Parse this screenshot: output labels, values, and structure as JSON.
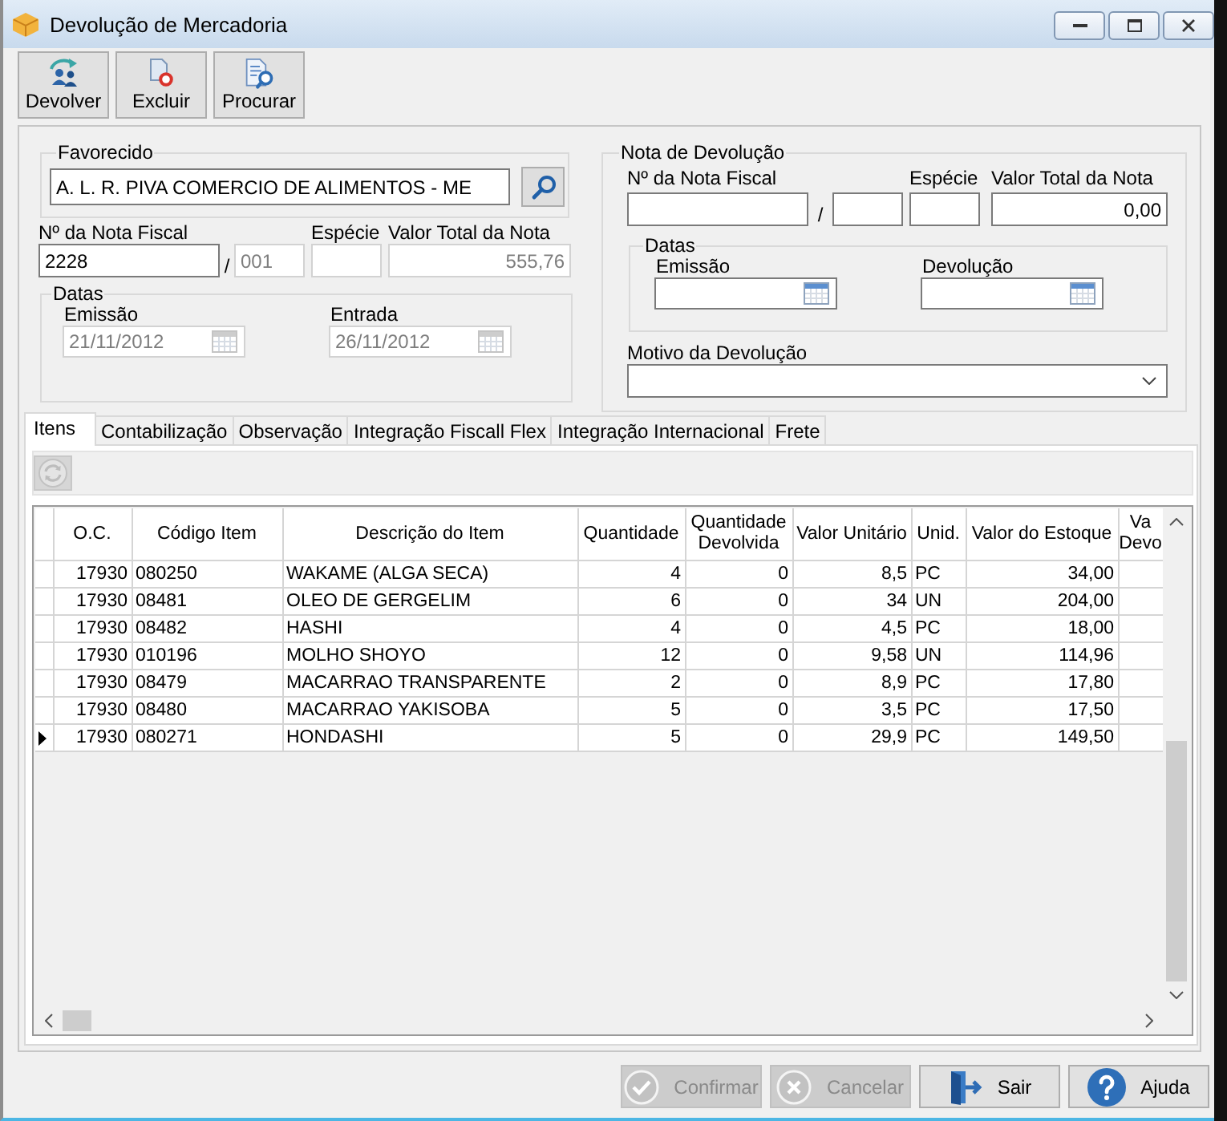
{
  "window": {
    "title": "Devolução de Mercadoria"
  },
  "toolbar": [
    {
      "kind": "return",
      "label": "Devolver"
    },
    {
      "kind": "delete",
      "label": "Excluir"
    },
    {
      "kind": "find",
      "label": "Procurar"
    }
  ],
  "favorecido": {
    "legend": "Favorecido",
    "field": {
      "value": "A. L. R. PIVA COMERCIO DE ALIMENTOS - ME",
      "disabled": false
    }
  },
  "nota_fiscal": {
    "number_label": "Nº da Nota Fiscal",
    "number": {
      "value": "2228",
      "disabled": false
    },
    "separator": "/",
    "series": {
      "value": "001",
      "disabled": true
    },
    "especie_label": "Espécie",
    "especie": {
      "disabled": true
    },
    "total_label": "Valor Total da Nota",
    "total": {
      "value": "555,76",
      "disabled": true
    },
    "datas": {
      "legend": "Datas",
      "fields": [
        {
          "label": "Emissão",
          "value": "21/11/2012",
          "disabled": true
        },
        {
          "label": "Entrada",
          "value": "26/11/2012",
          "disabled": true
        }
      ]
    }
  },
  "nota_devolucao": {
    "legend": "Nota de Devolução",
    "number_label": "Nº da Nota Fiscal",
    "number": {
      "disabled": false
    },
    "separator": "/",
    "series": {
      "disabled": false
    },
    "especie_label": "Espécie",
    "especie": {
      "disabled": false
    },
    "total_label": "Valor Total da Nota",
    "total": {
      "value": "0,00",
      "disabled": false
    },
    "datas": {
      "legend": "Datas",
      "fields": [
        {
          "label": "Emissão",
          "disabled": false
        },
        {
          "label": "Devolução",
          "disabled": false
        }
      ]
    },
    "motivo_label": "Motivo da Devolução",
    "motivo": {
      "disabled": false
    }
  },
  "tabs": [
    {
      "label": "Itens",
      "selected": true
    },
    {
      "label": "Contabilização",
      "selected": false
    },
    {
      "label": "Observação",
      "selected": false
    },
    {
      "label": "Integração Fiscall Flex",
      "selected": false
    },
    {
      "label": "Integração Internacional",
      "selected": false
    },
    {
      "label": "Frete",
      "selected": false
    }
  ],
  "items_toolbar": {
    "refresh_disabled": true
  },
  "grid": {
    "columns": [
      "O.C.",
      "Código Item",
      "Descrição do Item",
      "Quantidade",
      "Quantidade Devolvida",
      "Valor Unitário",
      "Unid.",
      "Valor do Estoque",
      "Va Devo"
    ],
    "rows": [
      {
        "cells": [
          "17930",
          "080250",
          "WAKAME (ALGA SECA)",
          "4",
          "0",
          "8,5",
          "PC",
          "34,00"
        ],
        "selected": false
      },
      {
        "cells": [
          "17930",
          "08481",
          "OLEO DE GERGELIM",
          "6",
          "0",
          "34",
          "UN",
          "204,00"
        ],
        "selected": false
      },
      {
        "cells": [
          "17930",
          "08482",
          "HASHI",
          "4",
          "0",
          "4,5",
          "PC",
          "18,00"
        ],
        "selected": false
      },
      {
        "cells": [
          "17930",
          "010196",
          "MOLHO SHOYO",
          "12",
          "0",
          "9,58",
          "UN",
          "114,96"
        ],
        "selected": false
      },
      {
        "cells": [
          "17930",
          "08479",
          "MACARRAO TRANSPARENTE",
          "2",
          "0",
          "8,9",
          "PC",
          "17,80"
        ],
        "selected": false
      },
      {
        "cells": [
          "17930",
          "08480",
          "MACARRAO YAKISOBA",
          "5",
          "0",
          "3,5",
          "PC",
          "17,50"
        ],
        "selected": false
      },
      {
        "cells": [
          "17930",
          "080271",
          "HONDASHI",
          "5",
          "0",
          "29,9",
          "PC",
          "149,50"
        ],
        "selected": true
      }
    ]
  },
  "buttons": [
    {
      "kind": "confirm",
      "label": "Confirmar",
      "disabled": true
    },
    {
      "kind": "cancel",
      "label": "Cancelar",
      "disabled": true
    },
    {
      "kind": "exit",
      "label": "Sair",
      "disabled": false
    },
    {
      "kind": "help",
      "label": "Ajuda",
      "disabled": false
    }
  ]
}
